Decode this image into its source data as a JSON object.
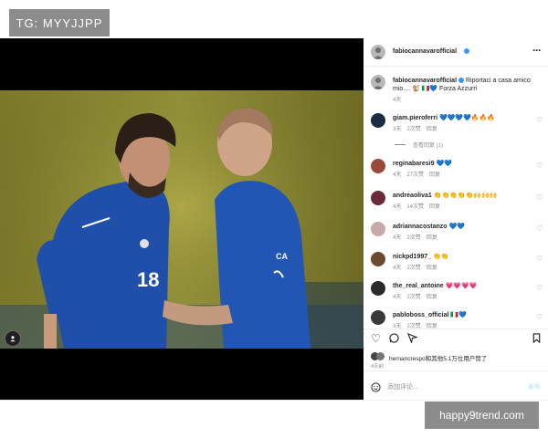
{
  "tag": "TG: MYYJJPP",
  "watermark": "happy9trend.com",
  "post": {
    "username": "fabiocannavarofficial",
    "more_icon": "more-horizontal-icon",
    "caption_user": "fabiocannavarofficial",
    "caption_text": "Riportaci a casa amico mio.... 🐒 🇮🇹💙 Forza Azzurri",
    "caption_time": "4天",
    "player_number": "18",
    "player_name_back": "CA",
    "comments": [
      {
        "user": "giam.pieroferri",
        "text": "💙💙💙💙🔥🔥🔥",
        "time": "3天",
        "likes": "2次赞",
        "reply": "回复",
        "avatar_color": "#1c2a44"
      },
      {
        "user": "reginabaresi9",
        "text": "💙💙",
        "time": "4天",
        "likes": "27次赞",
        "reply": "回复",
        "avatar_color": "#9a4a3a"
      },
      {
        "user": "andreaoliva1",
        "text": "👏👏👏👏👏🙌🙌🙌",
        "time": "4天",
        "likes": "14次赞",
        "reply": "回复",
        "avatar_color": "#6b2a3a"
      },
      {
        "user": "adriannacostanzo",
        "text": "💙💙",
        "time": "4天",
        "likes": "2次赞",
        "reply": "回复",
        "avatar_color": "#c8a8a8"
      },
      {
        "user": "nickpd1997_",
        "text": "👏👏",
        "time": "4天",
        "likes": "2次赞",
        "reply": "回复",
        "avatar_color": "#6b4a30"
      },
      {
        "user": "the_real_antoine",
        "text": "💗💗💗💗",
        "time": "4天",
        "likes": "2次赞",
        "reply": "回复",
        "avatar_color": "#2a2a2a"
      },
      {
        "user": "pabloboss_official",
        "text": "🇮🇹💙",
        "time": "3天",
        "likes": "2次赞",
        "reply": "回复",
        "avatar_color": "#3a3a3a"
      }
    ],
    "view_replies": "查看回复 (1)",
    "liked_by": "hernancrespo和其他5.1万位用户赞了",
    "post_time": "4天前",
    "comment_placeholder": "添加评论...",
    "post_button": "发布"
  },
  "icons": {
    "like": "heart-icon",
    "comment": "comment-icon",
    "share": "share-icon",
    "save": "bookmark-icon",
    "emoji": "emoji-icon",
    "multi": "user-tag-icon"
  }
}
